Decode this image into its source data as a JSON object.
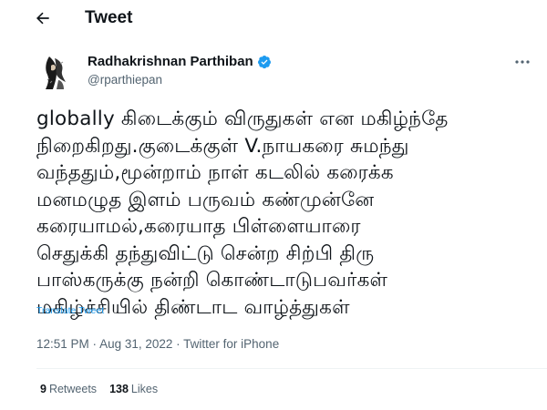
{
  "header": {
    "title": "Tweet",
    "back_icon": "arrow-left-icon"
  },
  "author": {
    "display_name": "Radhakrishnan Parthiban",
    "handle": "@rparthiepan",
    "verified_icon": "verified-badge-icon",
    "verified_color": "#1d9bf0"
  },
  "tweet": {
    "text": "globally கிடைக்கும் விருதுகள் என மகிழ்ந்தே\nநிறைகிறது.குடைக்குள் V.நாயகரை சுமந்து\nவந்ததும்,மூன்றாம் நாள் கடலில் கரைக்க\nமனமழுத இளம் பருவம் கண்முன்னே\nகரையாமல்,கரையாத பிள்ளையாரை\nசெதுக்கி தந்துவிட்டு சென்ற சிற்பி திரு\nபாஸ்கருக்கு நன்றி கொண்டாடுபவர்கள்\nமகிழ்ச்சியில் திண்டாட வாழ்த்துகள்",
    "translate_label": "Translate Tweet",
    "time": "12:51 PM",
    "date": "Aug 31, 2022",
    "source": "Twitter for iPhone",
    "separator": " · "
  },
  "stats": {
    "retweets_count": "9",
    "retweets_label": "Retweets",
    "likes_count": "138",
    "likes_label": "Likes"
  },
  "colors": {
    "accent": "#1d9bf0",
    "text": "#0f1419",
    "secondary": "#536471"
  }
}
